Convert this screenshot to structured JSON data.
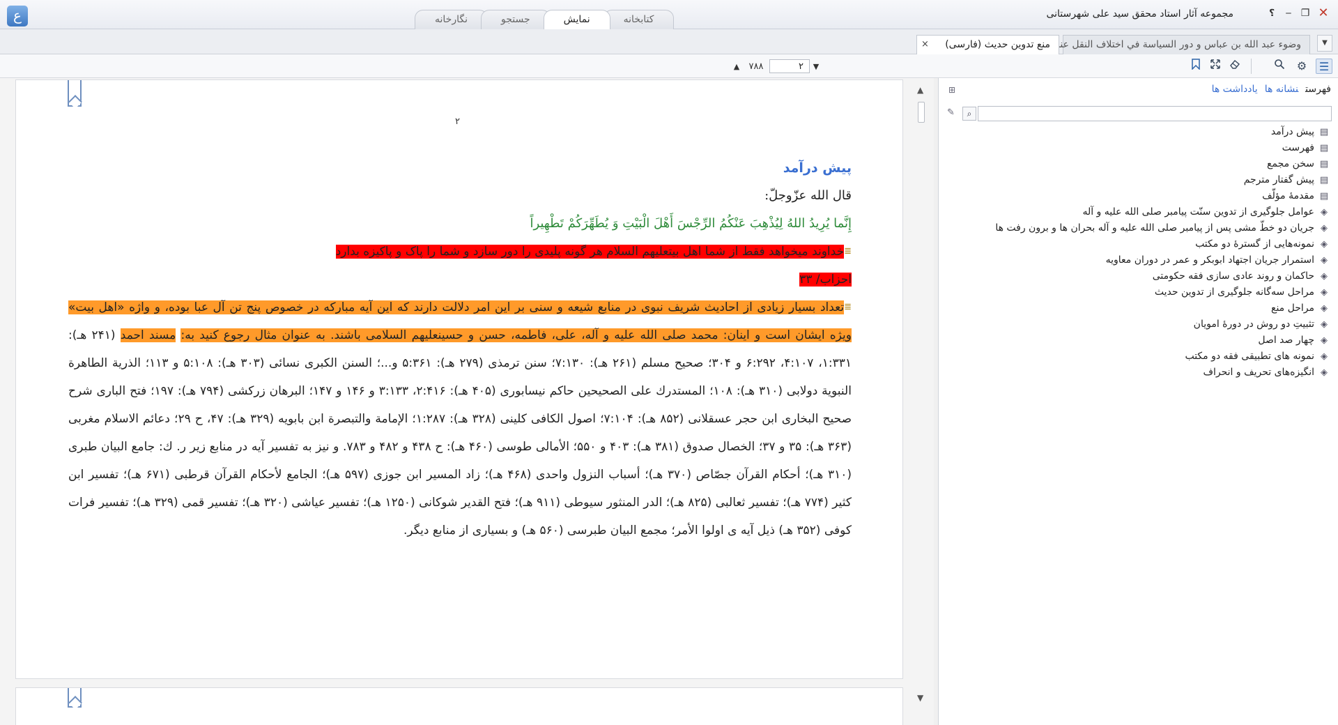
{
  "window": {
    "title": "مجموعه آثار استاد محقق سید علی شهرستانی",
    "logo": "ع",
    "help": "؟",
    "minimize": "‒",
    "maximize": "❐",
    "close": "✕"
  },
  "main_tabs": [
    {
      "label": "نگارخانه",
      "active": false
    },
    {
      "label": "جستجو",
      "active": false
    },
    {
      "label": "نمایش",
      "active": true
    },
    {
      "label": "کتابخانه",
      "active": false
    }
  ],
  "doc_tabs": [
    {
      "label": "وضوء عبد الله بن عباس و دور السياسة في اختلاف النقل عنه",
      "active": false
    },
    {
      "label": "منع تدوين حديث (فارسى)",
      "active": true,
      "close": "×"
    }
  ],
  "doc_tabs_menu": "▼",
  "toolbar": {
    "icons": [
      "list-icon",
      "gear-icon",
      "search-icon",
      "eraser-icon",
      "fullscreen-icon",
      "bookmark-icon"
    ],
    "pager": {
      "up": "▲",
      "total": "۷۸۸",
      "current": "۲",
      "down": "▼"
    }
  },
  "document": {
    "page_number": "۲",
    "section_title": "پیش درآمد",
    "quote_intro": "قال الله عزّوجلّ:",
    "verse": "إِنَّما يُرِيدُ اللهُ لِيُذْهِبَ عَنْكُمُ الرِّجْسَ أَهْلَ الْبَيْتِ وَ يُطَهِّرَكُمْ تَطْهِيراً",
    "translation": "خداوند میخواهد فقط از شما اهل بیتعلیهم السلام هر گونه پلیدی را دور سازد و شما را پاک و پاکیزه بدارد",
    "reference": "احزاب/ ۳۳",
    "footnote_highlight": "تعداد بسیار زیادی از احادیث شریف نبوی در منابع شیعه و سنی بر این امر دلالت دارند که این آیه مبارکه در خصوص پنج تن آل عبا بوده، و واژه «اهل بیت» ویژه ایشان است و اینان: محمد صلی الله علیه و آله، علی، فاطمه، حسن و حسینعلیهم السلامی باشند. به عنوان مثال رجوع کنید به:",
    "footnote_source_hl": "مسند احمد",
    "footnote_rest": "(۲۴۱ هـ): ۱:۳۳۱، ۴:۱۰۷، ۶:۲۹۲ و ۳۰۴؛ صحيح مسلم (۲۶۱ هـ): ۷:۱۳۰؛ سنن ترمذی (۲۷۹ هـ): ۵:۳۶۱ و...؛ السنن الكبرى نسائی (۳۰۳ هـ): ۵:۱۰۸ و ۱۱۳؛ الذرية الطاهرة النبوية دولابی (۳۱۰ هـ): ۱۰۸؛ المستدرك على الصحيحين حاكم نيسابوری (۴۰۵ هـ): ۲:۴۱۶، ۳:۱۳۳ و ۱۴۶ و ۱۴۷؛ البرهان زركشی (۷۹۴ هـ): ۱۹۷؛ فتح الباری شرح صحيح البخاری ابن حجر عسقلانی (۸۵۲ هـ): ۷:۱۰۴؛ اصول الكافی كلينی (۳۲۸ هـ): ۱:۲۸۷؛ الإمامة والتبصرة ابن بابويه (۳۲۹ هـ): ۴۷، ح ۲۹؛ دعائم الاسلام مغربی (۳۶۳ هـ): ۳۵ و ۳۷؛ الخصال صدوق (۳۸۱ هـ): ۴۰۳ و ۵۵۰؛ الأمالی طوسی (۴۶۰ هـ): ح ۴۳۸ و ۴۸۲ و ۷۸۳. و نيز به تفسير آيه در منابع زير ر. ك: جامع البيان طبری (۳۱۰ هـ)؛ أحكام القرآن جصّاص (۳۷۰ هـ)؛ أسباب النزول واحدی (۴۶۸ هـ)؛ زاد المسير ابن جوزی (۵۹۷ هـ)؛ الجامع لأحكام القرآن قرطبی (۶۷۱ هـ)؛ تفسير ابن كثير (۷۷۴ هـ)؛ تفسير ثعالبی (۸۲۵ هـ)؛ الدر المنثور سيوطی (۹۱۱ هـ)؛ فتح القدير شوكانی (۱۲۵۰ هـ)؛ تفسير عياشی (۳۲۰ هـ)؛ تفسير قمی (۳۲۹ هـ)؛ تفسير فرات كوفی (۳۵۲ هـ) ذيل آيه ی اولوا الأمر؛ مجمع البيان طبرسی (۵۶۰ هـ) و بسياری از منابع ديگر.",
    "note_mark": "≣"
  },
  "scrollbar": {
    "up": "▲",
    "down": "▼"
  },
  "side_panel": {
    "tabs": {
      "index": "فهرست",
      "bookmarks": "نشانه ها",
      "notes": "یادداشت ها"
    },
    "search_placeholder": "",
    "toc": [
      {
        "label": "پیش درآمد",
        "icon": "page-icon"
      },
      {
        "label": "فهرست",
        "icon": "page-icon"
      },
      {
        "label": "سخن مجمع",
        "icon": "page-icon"
      },
      {
        "label": "پیش گفتار مترجم",
        "icon": "page-icon"
      },
      {
        "label": "مقدمهٔ مؤلّف",
        "icon": "page-icon"
      },
      {
        "label": "عوامل جلوگیری از تدوین سنّت پیامبر صلی الله علیه و آله",
        "icon": "stack-icon"
      },
      {
        "label": "جریان دو خطّ مشی پس از پیامبر صلی الله علیه و آله بحران ها و برون رفت ها",
        "icon": "stack-icon"
      },
      {
        "label": "نمونه‌هایی از گسترهٔ دو مکتب",
        "icon": "stack-icon"
      },
      {
        "label": "استمرار جریان اجتهاد ابوبکر و عمر در دوران معاویه",
        "icon": "stack-icon"
      },
      {
        "label": "حاکمان و روند عادی سازی فقه حکومتی",
        "icon": "stack-icon"
      },
      {
        "label": "مراحل سه‌گانه جلوگیری از تدوین حدیث",
        "icon": "stack-icon"
      },
      {
        "label": "مراحل منع",
        "icon": "stack-icon"
      },
      {
        "label": "تثبیتِ دو روش در دورهٔ امویان",
        "icon": "stack-icon"
      },
      {
        "label": "چهار صد اصل",
        "icon": "stack-icon"
      },
      {
        "label": "نمونه های تطبیقی فقه دو مکتب",
        "icon": "stack-icon"
      },
      {
        "label": "انگیزه‌های تحریف و انحراف",
        "icon": "stack-icon"
      }
    ]
  }
}
